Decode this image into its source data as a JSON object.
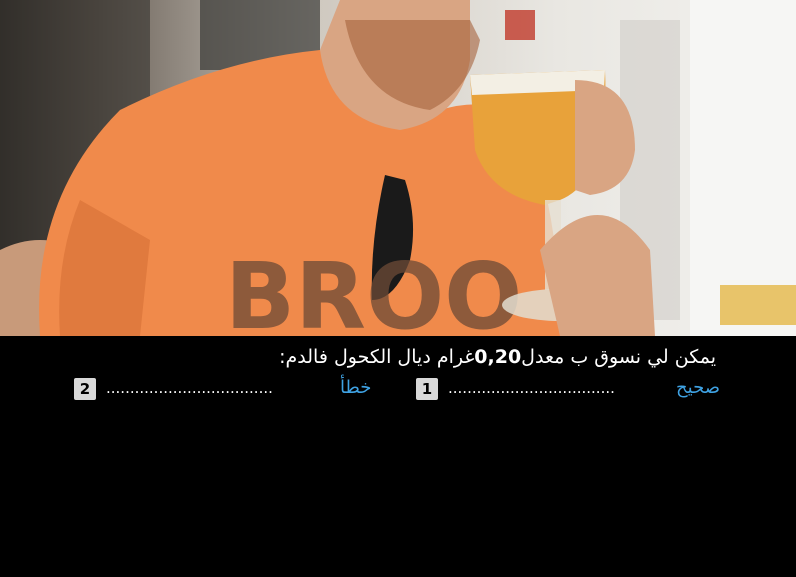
{
  "photo": {
    "description_icon": "photo-icon",
    "shirt_text": "BROO"
  },
  "question": {
    "part1": "يمكن لي نسوق ب معدل",
    "number": "0,20",
    "part2": "غرام ديال الكحول فالدم:"
  },
  "answers": [
    {
      "label": "صحيح",
      "dots": "...................................",
      "badge": "1"
    },
    {
      "label": "خطأ",
      "dots": "...................................",
      "badge": "2"
    }
  ],
  "colors": {
    "answer_label": "#3fa2e3",
    "background": "#000000",
    "shirt": "#f08a4b"
  }
}
